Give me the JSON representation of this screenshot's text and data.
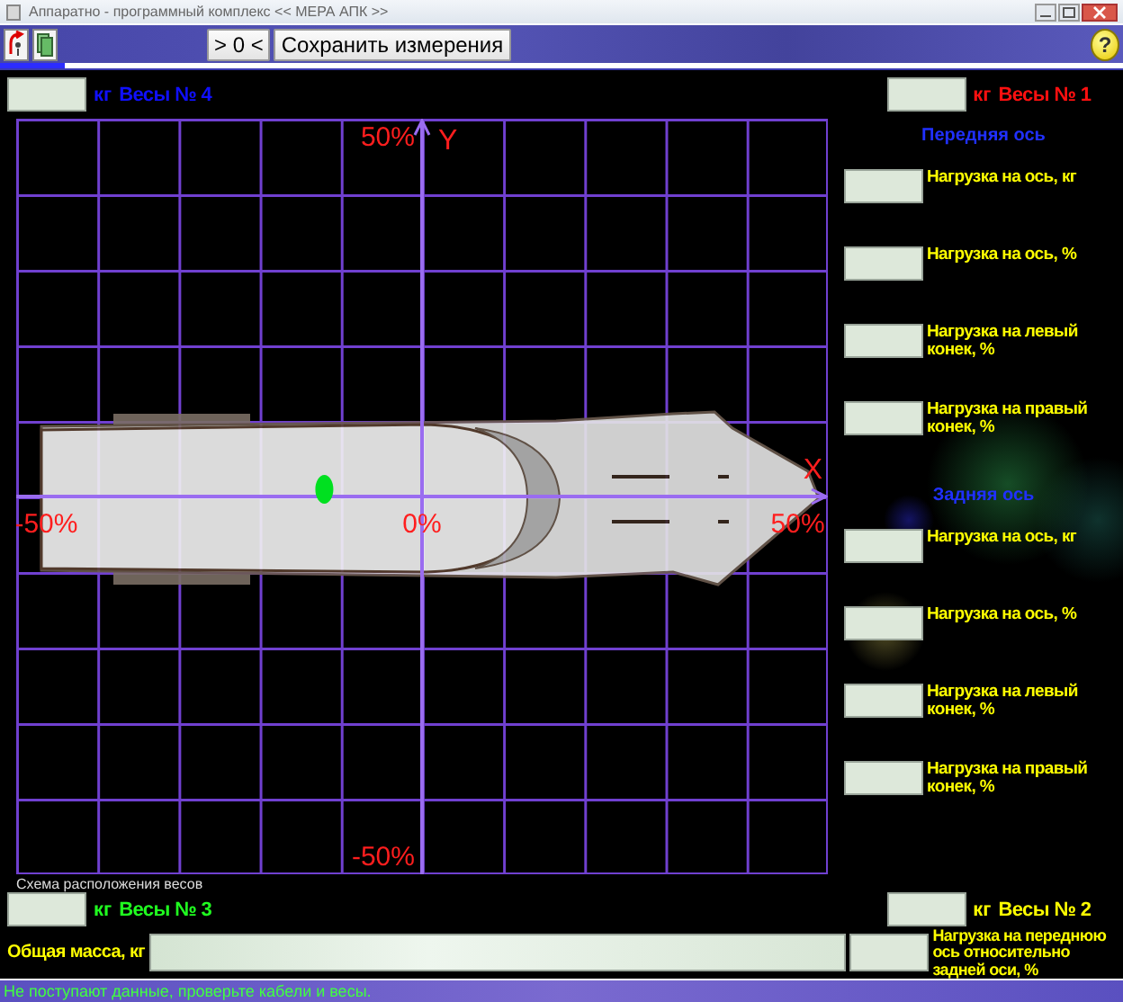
{
  "window": {
    "title": "Аппаратно - программный комплекс << МЕРА АПК >>"
  },
  "toolbar": {
    "buttons": [
      {
        "label": "> 0 <"
      },
      {
        "label": "Сохранить измерения"
      }
    ],
    "help": "?"
  },
  "scales": [
    {
      "unit": "кг",
      "name": "Весы № 4",
      "color": "#1010ff"
    },
    {
      "unit": "кг",
      "name": "Весы № 1",
      "color": "#ff1010"
    },
    {
      "unit": "кг",
      "name": "Весы № 3",
      "color": "#20ff20"
    },
    {
      "unit": "кг",
      "name": "Весы № 2",
      "color": "#ffff00"
    }
  ],
  "diagram": {
    "caption": "Схема расположения весов",
    "chart_data": {
      "type": "scatter",
      "xlabel": "X",
      "ylabel": "Y",
      "xlim": [
        -54,
        54
      ],
      "ylim": [
        -52.5,
        52.5
      ],
      "xticks": [
        {
          "value": -50,
          "label": "-50%"
        },
        {
          "value": 0,
          "label": "0%"
        },
        {
          "value": 50,
          "label": "50%"
        }
      ],
      "yticks": [
        {
          "value": 50,
          "label": "50%"
        },
        {
          "value": -50,
          "label": "-50%"
        }
      ],
      "series": [
        {
          "color": "#00e020",
          "x": [
            -13
          ],
          "values": [
            1
          ]
        }
      ]
    }
  },
  "axles": [
    {
      "title": "Передняя ось",
      "rows": [
        {
          "label": "Нагрузка на ось, кг"
        },
        {
          "label": "Нагрузка на ось, %"
        },
        {
          "label": "Нагрузка на левый конек, %"
        },
        {
          "label": "Нагрузка на правый конек, %"
        }
      ]
    },
    {
      "title": "Задняя ось",
      "rows": [
        {
          "label": "Нагрузка на ось, кг"
        },
        {
          "label": "Нагрузка на ось, %"
        },
        {
          "label": "Нагрузка на левый конек, %"
        },
        {
          "label": "Нагрузка на правый конек, %"
        }
      ]
    }
  ],
  "total": {
    "label": "Общая масса, кг"
  },
  "ratio": {
    "label": "Нагрузка на переднюю ось относительно задней оси, %"
  },
  "status_bar": {
    "text": "Не поступают данные, проверьте кабели и весы."
  }
}
